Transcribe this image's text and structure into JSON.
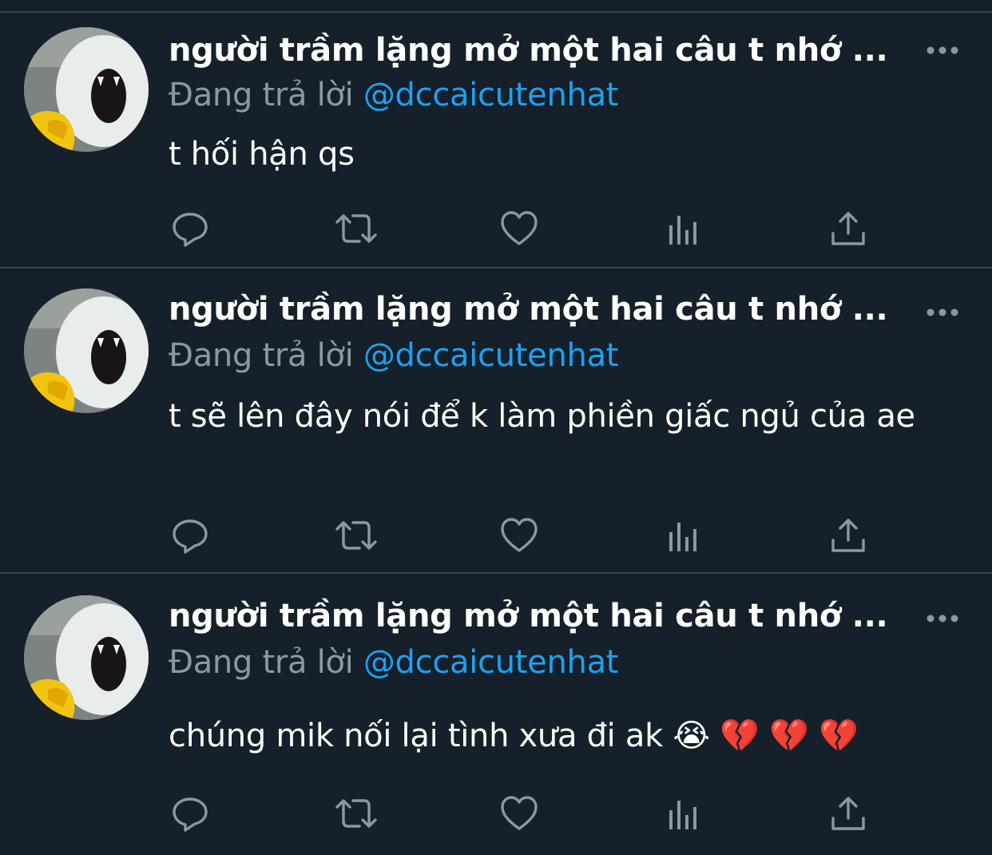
{
  "tweets": [
    {
      "author_name": "người trầm lặng mở một hai câu t nhớ ...",
      "replying_prefix": "Đang trả lời",
      "replying_handle": "@dccaicutenhat",
      "text": "t hối hận qs"
    },
    {
      "author_name": "người trầm lặng mở một hai câu t nhớ ...",
      "replying_prefix": "Đang trả lời",
      "replying_handle": "@dccaicutenhat",
      "text": "t sẽ lên đây nói để k làm phiền giấc ngủ của ae"
    },
    {
      "author_name": "người trầm lặng mở một hai câu t nhớ ...",
      "replying_prefix": "Đang trả lời",
      "replying_handle": "@dccaicutenhat",
      "text": "chúng mik nối lại tình xưa đi ak 😭 💔 💔 💔"
    }
  ],
  "icons": {
    "action_bar": [
      "reply-icon",
      "retweet-icon",
      "like-icon",
      "analytics-icon",
      "share-icon"
    ],
    "more": "more-options-icon"
  },
  "colors": {
    "background": "#15202b",
    "divider": "#38444d",
    "text_primary": "#ffffff",
    "text_secondary": "#8899a6",
    "link": "#1da1f2",
    "icon": "#8899a6"
  }
}
